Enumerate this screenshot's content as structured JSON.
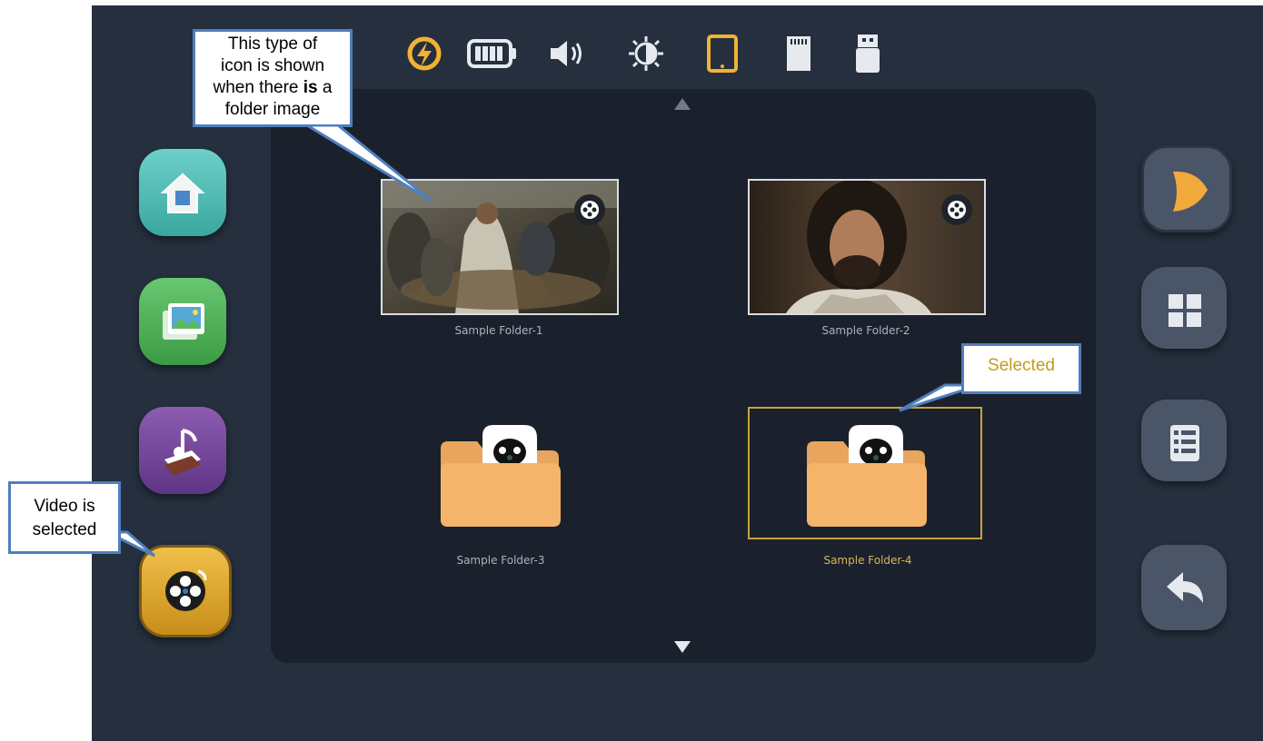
{
  "folders": [
    {
      "label": "Sample Folder-1",
      "has_image": true
    },
    {
      "label": "Sample Folder-2",
      "has_image": true
    },
    {
      "label": "Sample Folder-3",
      "has_image": false
    },
    {
      "label": "Sample Folder-4",
      "has_image": false,
      "selected": true
    }
  ],
  "callouts": {
    "folder_image_lines": [
      "This type of",
      "icon is shown",
      "when there",
      "is",
      "a",
      "folder image"
    ],
    "selected": "Selected",
    "video_selected_lines": [
      "Video is",
      "selected"
    ]
  },
  "status_icons": [
    "charging-icon",
    "battery-icon",
    "volume-icon",
    "brightness-icon",
    "tablet-icon",
    "sd-card-icon",
    "usb-icon"
  ],
  "left_nav": [
    "home-icon",
    "photos-icon",
    "music-icon",
    "video-icon"
  ],
  "right_nav": [
    "play-icon",
    "grid-view-icon",
    "list-view-icon",
    "back-icon"
  ],
  "colors": {
    "accent": "#f2b233",
    "selected_label": "#c49a1e",
    "callout_border": "#4f7fbe"
  }
}
